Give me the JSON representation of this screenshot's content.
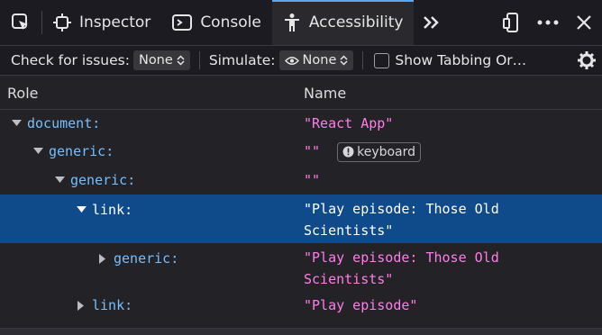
{
  "toolbar": {
    "tabs": [
      {
        "label": "Inspector",
        "icon": "inspector-icon"
      },
      {
        "label": "Console",
        "icon": "console-icon"
      },
      {
        "label": "Accessibility",
        "icon": "accessibility-icon"
      }
    ],
    "active_tab": "Accessibility",
    "accent": "#53a8f9"
  },
  "filterbar": {
    "check_label": "Check for issues:",
    "check_value": "None",
    "simulate_label": "Simulate:",
    "simulate_value": "None",
    "tabbing_label": "Show Tabbing Or…"
  },
  "header": {
    "role": "Role",
    "name": "Name"
  },
  "tree": [
    {
      "role": "document:",
      "name": "\"React App\"",
      "expanded": true
    },
    {
      "role": "generic:",
      "name": "\"\"",
      "expanded": true,
      "badge": "keyboard"
    },
    {
      "role": "generic:",
      "name": "\"\"",
      "expanded": true
    },
    {
      "role": "link:",
      "name_line1": "\"Play episode: Those Old",
      "name_line2": "Scientists\"",
      "expanded": true,
      "selected": true
    },
    {
      "role": "generic:",
      "name_line1": "\"Play episode: Those Old",
      "name_line2": "Scientists\"",
      "expanded": false
    },
    {
      "role": "link:",
      "name": "\"Play episode\"",
      "expanded": false
    }
  ],
  "colors": {
    "role": "#75bfff",
    "name": "#ff7de9",
    "selected_bg": "#0f4a8a"
  }
}
